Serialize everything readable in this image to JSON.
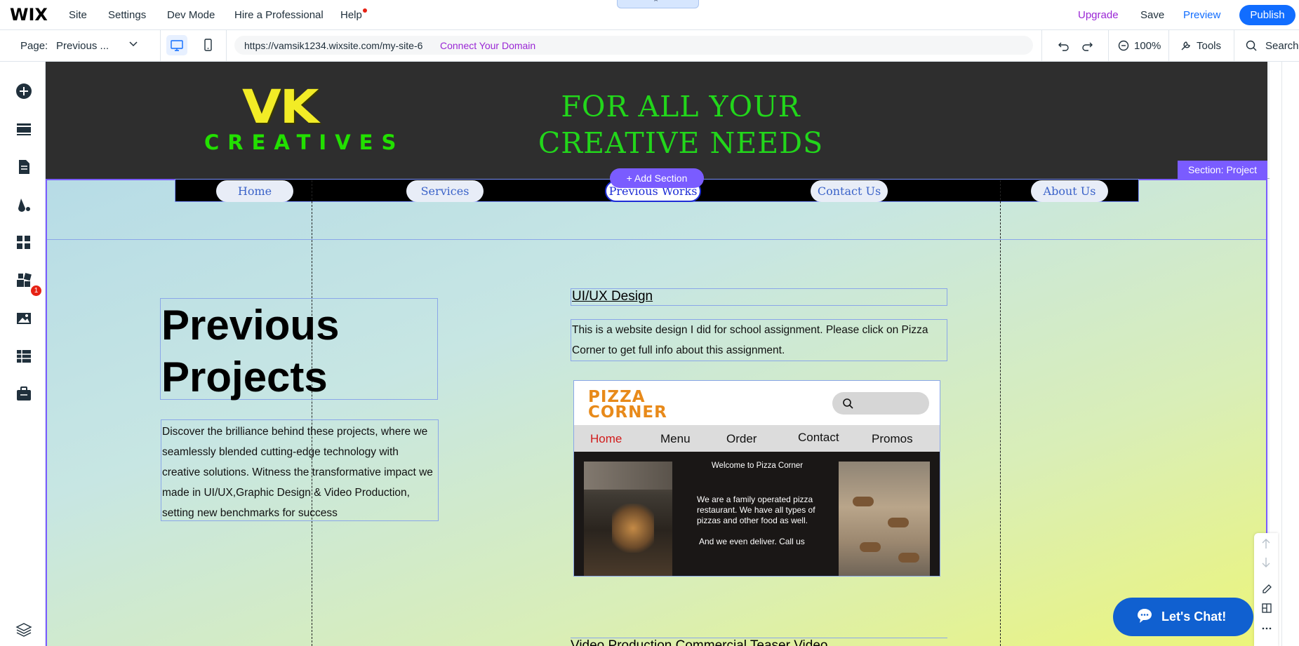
{
  "topbar": {
    "logo": "WIX",
    "menu": [
      "Site",
      "Settings",
      "Dev Mode",
      "Hire a Professional",
      "Help"
    ],
    "collapse_glyph": "⌃",
    "upgrade": "Upgrade",
    "save": "Save",
    "preview": "Preview",
    "publish": "Publish"
  },
  "secbar": {
    "page_label": "Page:",
    "page_value": "Previous ...",
    "url": "https://vamsik1234.wixsite.com/my-site-6",
    "connect_domain": "Connect Your Domain",
    "zoom": "100%",
    "tools": "Tools",
    "search": "Search"
  },
  "rail": {
    "icons": [
      "add-elements-icon",
      "sections-icon",
      "pages-icon",
      "design-icon",
      "apps-icon",
      "business-tools-icon",
      "media-icon",
      "cms-icon",
      "portfolio-icon",
      "layers-icon"
    ],
    "apps_badge": "1"
  },
  "site": {
    "logo_top": "VK",
    "logo_bottom": "CREATIVES",
    "tagline_line1": "FOR ALL YOUR",
    "tagline_line2": "CREATIVE NEEDS",
    "nav": [
      "Home",
      "Services",
      "Previous Works",
      "Contact Us",
      "About Us"
    ],
    "active_nav": "Previous Works",
    "section_tag": "Section: Project",
    "add_section": "+ Add Section",
    "prev_title_1": "Previous",
    "prev_title_2": "Projects",
    "description": "Discover the brilliance behind these projects, where we seamlessly blended cutting-edge technology with creative solutions. Witness the transformative impact we made in UI/UX,Graphic Design & Video Production, setting new benchmarks for success",
    "uiux_title": "UI/UX Design",
    "uiux_desc": "This is a website design I did for school assignment. Please click on Pizza Corner to get full info about this assignment.",
    "bottom_cut_text": "Video Production Commercial Teaser Video"
  },
  "mockup": {
    "logo_line1": "PIZZA",
    "logo_line2": "CORNER",
    "nav": [
      "Home",
      "Menu",
      "Order",
      "Contact",
      "Promos"
    ],
    "welcome": "Welcome to Pizza Corner",
    "text1": "We are a family operated pizza restaurant.  We have all types of pizzas and other food as well.",
    "text2": "And we even deliver. Call us"
  },
  "chat": {
    "label": "Let's Chat!"
  },
  "colors": {
    "accent": "#116dff",
    "section_purple": "#7a5cff",
    "upgrade_purple": "#9a27d5",
    "logo_yellow": "#f2ec26",
    "logo_green": "#22e000",
    "pizza_orange": "#e88a1a"
  }
}
